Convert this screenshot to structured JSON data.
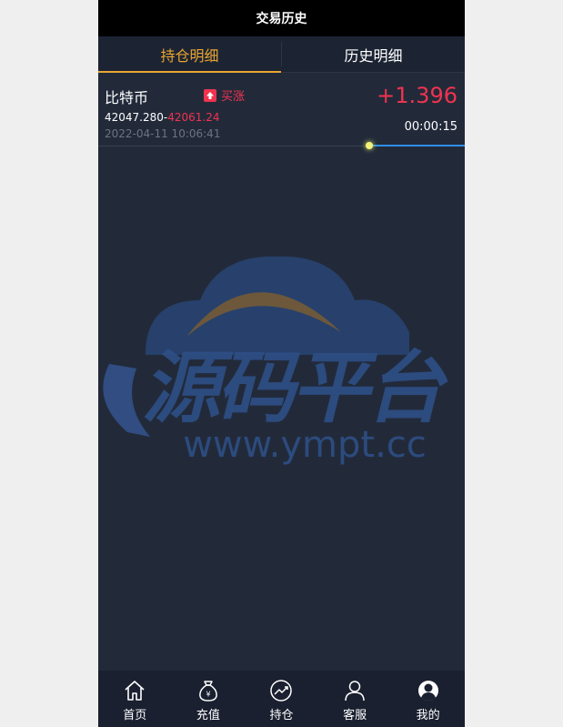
{
  "header": {
    "title": "交易历史"
  },
  "tabs": [
    {
      "label": "持仓明细",
      "active": true
    },
    {
      "label": "历史明细",
      "active": false
    }
  ],
  "order": {
    "coin": "比特币",
    "direction": "买涨",
    "direction_icon": "arrow-up-icon",
    "open_price": "42047.280",
    "separator": "-",
    "current_price": "42061.24",
    "time": "2022-04-11 10:06:41",
    "profit": "+1.396",
    "countdown": "00:00:15"
  },
  "watermark": {
    "text": "源码平台",
    "url": "www.ympt.cc"
  },
  "bottom_nav": [
    {
      "label": "首页",
      "icon": "home-icon"
    },
    {
      "label": "充值",
      "icon": "money-bag-icon"
    },
    {
      "label": "持仓",
      "icon": "chart-circle-icon"
    },
    {
      "label": "客服",
      "icon": "person-icon"
    },
    {
      "label": "我的",
      "icon": "user-avatar-icon"
    }
  ],
  "colors": {
    "background": "#222a3a",
    "accent": "#e8a630",
    "rise": "#f0334f",
    "progress": "#2f8de4"
  }
}
